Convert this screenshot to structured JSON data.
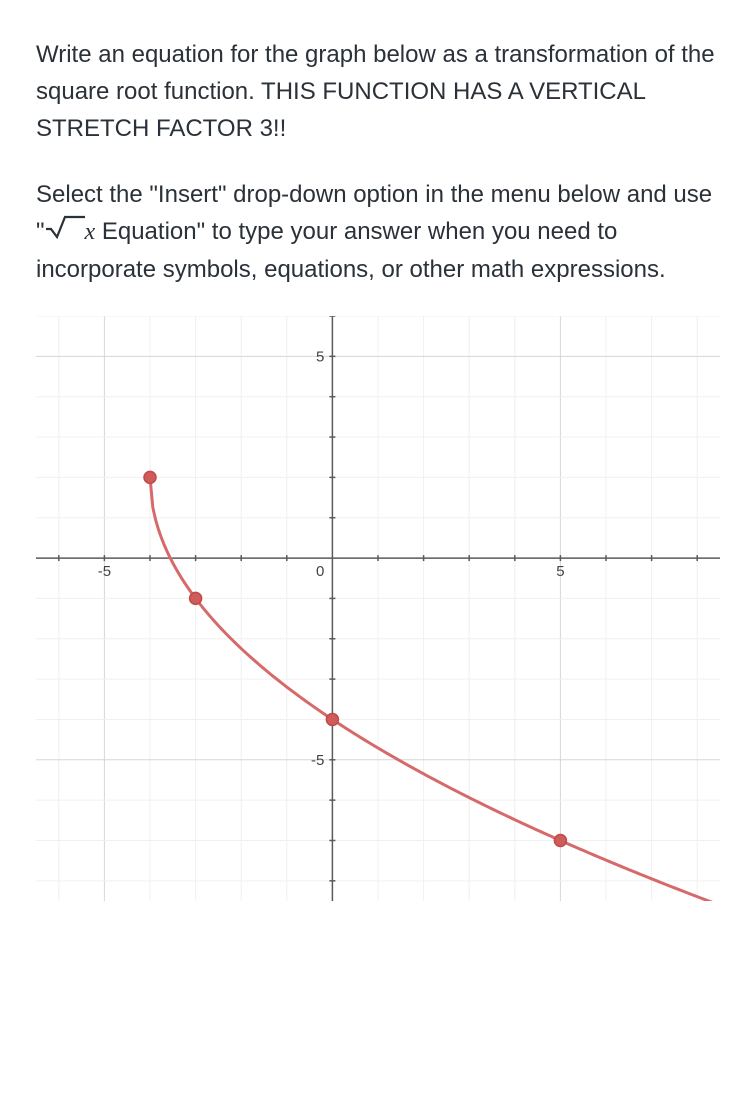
{
  "para1_a": "Write an equation for the graph below as a transformation of the square root function.  THIS FUNCTION HAS A VERTICAL STRETCH FACTOR 3!!",
  "para2_a": "Select the \"Insert\" drop-down option in the menu below and use \"",
  "eq_var": "x",
  "para2_b": " Equation\"  to type your answer when you need to incorporate symbols, equations, or other math expressions.",
  "chart_data": {
    "type": "line",
    "title": "",
    "xlabel": "",
    "ylabel": "",
    "xlim": [
      -6.5,
      8.5
    ],
    "ylim": [
      -8.5,
      6
    ],
    "x_ticks": [
      -5,
      0,
      5
    ],
    "y_ticks": [
      -5,
      5
    ],
    "origin_label": "0",
    "grid_minor_step": 1,
    "grid_major_step": 5,
    "curve": {
      "expr_hint": "y = -3*sqrt(x+4) + 2",
      "domain": [
        -4,
        8.5
      ],
      "samples": 200
    },
    "points": [
      {
        "x": -4,
        "y": 2
      },
      {
        "x": -3,
        "y": -1
      },
      {
        "x": 0,
        "y": -4
      },
      {
        "x": 5,
        "y": -7
      }
    ]
  },
  "colors": {
    "curve": "#d66a6a",
    "point": "#cf5b5b"
  }
}
